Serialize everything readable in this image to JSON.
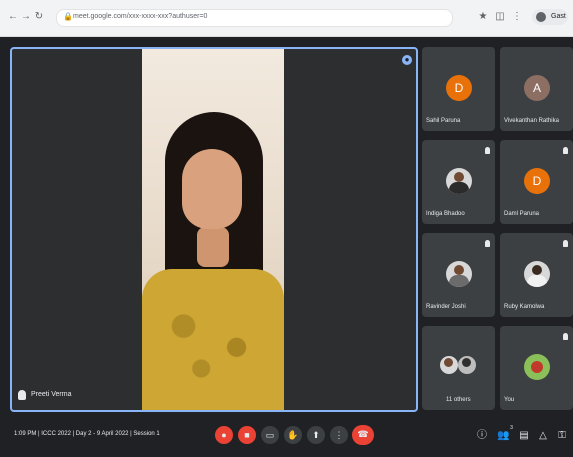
{
  "browser": {
    "url": "meet.google.com/xxx-xxxx-xxx?authuser=0",
    "profile_label": "Gast"
  },
  "main_speaker": {
    "name": "Preeti Verma"
  },
  "participants": [
    {
      "name": "Sahil Paruna",
      "initial": "D",
      "color": "#e8710a"
    },
    {
      "name": "Vivekanthan Rathika",
      "initial": "A",
      "color": "#8d6e63"
    },
    {
      "name": "Indiga Bhadoo",
      "initial": "",
      "color": ""
    },
    {
      "name": "Daml Paruna",
      "initial": "D",
      "color": "#e8710a"
    },
    {
      "name": "Ravinder Joshi",
      "initial": "",
      "color": ""
    },
    {
      "name": "Ruby Kamolwa",
      "initial": "",
      "color": ""
    },
    {
      "name": "11 others",
      "initial": "",
      "color": ""
    },
    {
      "name": "You",
      "initial": "",
      "color": ""
    }
  ],
  "bottom": {
    "meeting_info": "1:09 PM  |  ICCC 2022 | Day 2 - 9 April 2022 | Session 1",
    "participant_count": "3"
  },
  "icons": {
    "back": "back-icon",
    "forward": "forward-icon",
    "reload": "reload-icon",
    "mic": "mic-icon",
    "camera": "camera-icon",
    "captions": "captions-icon",
    "hand": "hand-icon",
    "present": "present-icon",
    "more": "more-icon",
    "end_call": "end-call-icon",
    "info": "info-icon",
    "people": "people-icon",
    "chat": "chat-icon",
    "activities": "activities-icon",
    "lock": "lock-icon"
  }
}
